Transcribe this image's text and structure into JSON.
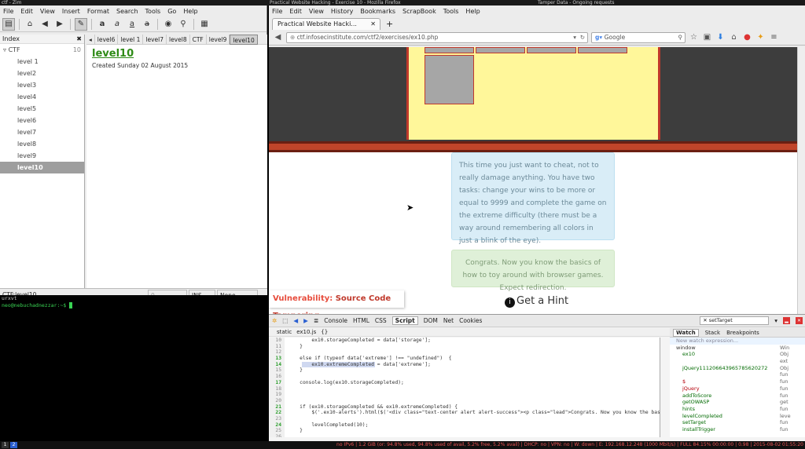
{
  "topbar": {
    "zim_title": "ctf - Zim",
    "ff_title": "Practical Website Hacking - Exercise 10 - Mozilla Firefox",
    "tamper_title": "Tamper Data - Ongoing requests"
  },
  "zim": {
    "menu": [
      "File",
      "Edit",
      "View",
      "Insert",
      "Format",
      "Search",
      "Tools",
      "Go",
      "Help"
    ],
    "index_header": "Index",
    "index_root": "CTF",
    "index_root_count": "10",
    "index_items": [
      "level 1",
      "level2",
      "level3",
      "level4",
      "level5",
      "level6",
      "level7",
      "level8",
      "level9",
      "level10"
    ],
    "path_tabs": [
      "level6",
      "level 1",
      "level7",
      "level8",
      "CTF",
      "level9",
      "level10"
    ],
    "page_title": "level10",
    "created": "Created Sunday 02 August 2015",
    "status": {
      "path": "CTF:level10",
      "backlinks": "0 Backlinks...",
      "mode": "INS",
      "style": "None"
    }
  },
  "terminal": {
    "title": "urxvt",
    "prompt": "neo@nebuchadnezzar:~$ "
  },
  "firefox": {
    "menu": [
      "File",
      "Edit",
      "View",
      "History",
      "Bookmarks",
      "ScrapBook",
      "Tools",
      "Help"
    ],
    "tab_label": "Practical Website Hacki...",
    "url": "ctf.infosecinstitute.com/ctf2/exercises/ex10.php",
    "search_placeholder": "Google",
    "info_text": "This time you just want to cheat, not to really damage anything. You have two tasks: change your wins to be more or equal to 9999 and complete the game on the extreme difficulty (there must be a way around remembering all colors in just a blink of the eye).",
    "success_text": "Congrats. Now you know the basics of how to toy around with browser games. Expect redirection.",
    "vuln_label": "Vulnerability:",
    "vuln_value": "Source Code Tampering",
    "hint": "Get a Hint"
  },
  "firebug": {
    "tabs": [
      "Console",
      "HTML",
      "CSS",
      "Script",
      "DOM",
      "Net",
      "Cookies"
    ],
    "active_tab": "Script",
    "search_value": "setTarget",
    "sub": {
      "static": "static",
      "file": "ex10.js"
    },
    "code": [
      {
        "n": "10",
        "t": "        ex10.storageCompleted = data['storage'];"
      },
      {
        "n": "11",
        "t": "    }"
      },
      {
        "n": "12",
        "t": ""
      },
      {
        "n": "13",
        "t": "    else if (typeof data['extreme'] !== \"undefined\")  {"
      },
      {
        "n": "14",
        "t": "        ex10.extremeCompleted = data['extreme'];"
      },
      {
        "n": "15",
        "t": "    }"
      },
      {
        "n": "16",
        "t": ""
      },
      {
        "n": "17",
        "t": "    console.log(ex10.storageCompleted);"
      },
      {
        "n": "18",
        "t": ""
      },
      {
        "n": "19",
        "t": ""
      },
      {
        "n": "20",
        "t": ""
      },
      {
        "n": "21",
        "t": "    if (ex10.storageCompleted && ex10.extremeCompleted) {"
      },
      {
        "n": "22",
        "t": "        $('.ex10-alerts').html($('<div class=\"text-center alert alert-success\"><p class=\"lead\">Congrats. Now you know the basic"
      },
      {
        "n": "23",
        "t": ""
      },
      {
        "n": "24",
        "t": "        levelCompleted(10);"
      },
      {
        "n": "25",
        "t": "    }"
      },
      {
        "n": "26",
        "t": ""
      },
      {
        "n": "27",
        "t": "}"
      }
    ],
    "watch_tabs": [
      "Watch",
      "Stack",
      "Breakpoints"
    ],
    "watch_new": "New watch expression...",
    "watch_rows": [
      {
        "n": "window",
        "v": "Win"
      },
      {
        "n": "ex10",
        "v": "Obj"
      },
      {
        "n": "",
        "v": "ext"
      },
      {
        "n": "jQuery1112066439657856202​72",
        "v": "Obj"
      },
      {
        "n": "",
        "v": "fun"
      },
      {
        "n": "$",
        "v": "fun"
      },
      {
        "n": "jQuery",
        "v": "fun"
      },
      {
        "n": "addToScore",
        "v": "fun"
      },
      {
        "n": "getOWASP",
        "v": "get"
      },
      {
        "n": "hints",
        "v": "fun"
      },
      {
        "n": "levelCompleted",
        "v": "leve"
      },
      {
        "n": "setTarget",
        "v": "fun"
      },
      {
        "n": "installTrigger",
        "v": "fun"
      }
    ]
  },
  "bottombar": {
    "workspaces": [
      "1",
      "2"
    ],
    "status": "no IPv6 | 1.2 GiB (or: 94.8% used, 94.8% used of avail, 5.2% free, 5.2% avail) | DHCP: no | VPN: no | W: down | E: 192.168.12.248 (1000 Mbit/s) | FULL 84.15% 00:00:00 | 0.98 | 2015-08-02 01:55:20"
  },
  "colors": {
    "zim_title": "#2e8b16",
    "vuln": "#c0392b",
    "info_bg": "#d9edf7",
    "success_bg": "#dff0d8",
    "game_bg": "#fff79a"
  }
}
